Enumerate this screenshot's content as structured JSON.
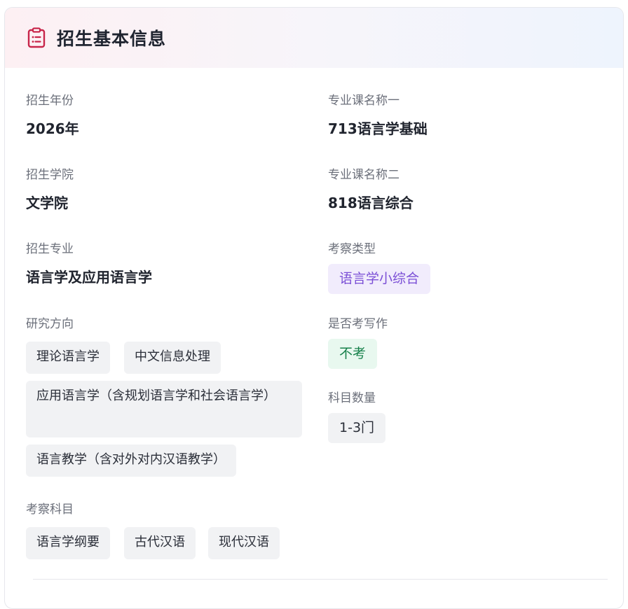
{
  "header": {
    "title": "招生基本信息",
    "icon": "clipboard-icon",
    "icon_color": "#c8254a"
  },
  "left": {
    "year": {
      "label": "招生年份",
      "value": "2026年"
    },
    "college": {
      "label": "招生学院",
      "value": "文学院"
    },
    "major": {
      "label": "招生专业",
      "value": "语言学及应用语言学"
    },
    "directions": {
      "label": "研究方向",
      "items": [
        "理论语言学",
        "中文信息处理",
        "应用语言学（含规划语言学和社会语言学）",
        "语言教学（含对外对内汉语教学）"
      ]
    },
    "subjects": {
      "label": "考察科目",
      "items": [
        "语言学纲要",
        "古代汉语",
        "现代汉语"
      ]
    }
  },
  "right": {
    "course1": {
      "label": "专业课名称一",
      "value": "713语言学基础"
    },
    "course2": {
      "label": "专业课名称二",
      "value": "818语言综合"
    },
    "exam_type": {
      "label": "考察类型",
      "value": "语言学小综合",
      "color": "#7b4fd6"
    },
    "writing": {
      "label": "是否考写作",
      "value": "不考",
      "color": "#16804a"
    },
    "subject_count": {
      "label": "科目数量",
      "value": "1-3门"
    }
  }
}
